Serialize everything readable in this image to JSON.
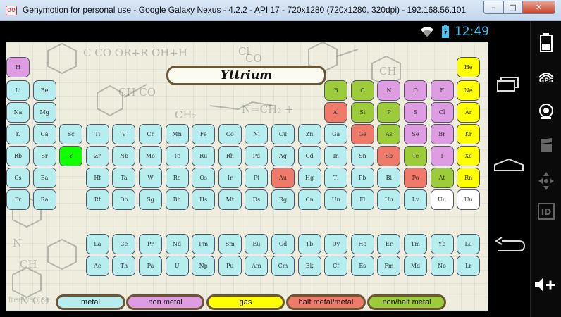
{
  "window": {
    "title": "Genymotion for personal use - Google Galaxy Nexus - 4.2.2 - API 17 - 720x1280 (720x1280, 320dpi) - 192.168.56.101",
    "app_icon": "oo",
    "min_glyph": "–",
    "max_glyph": "□",
    "close_glyph": "✕"
  },
  "status_bar": {
    "time": "12:49",
    "icons": [
      "wifi-icon",
      "battery-icon"
    ]
  },
  "app": {
    "selected_element": "Yttrium",
    "elements": [
      {
        "s": "H",
        "c": "nonmetal",
        "col": 0,
        "row": 0
      },
      {
        "s": "He",
        "c": "gas",
        "col": 17,
        "row": 0
      },
      {
        "s": "Li",
        "c": "metal",
        "col": 0,
        "row": 1
      },
      {
        "s": "Be",
        "c": "metal",
        "col": 1,
        "row": 1
      },
      {
        "s": "B",
        "c": "nonhalf",
        "col": 12,
        "row": 1
      },
      {
        "s": "C",
        "c": "nonhalf",
        "col": 13,
        "row": 1
      },
      {
        "s": "N",
        "c": "nonmetal",
        "col": 14,
        "row": 1
      },
      {
        "s": "O",
        "c": "nonmetal",
        "col": 15,
        "row": 1
      },
      {
        "s": "F",
        "c": "nonmetal",
        "col": 16,
        "row": 1
      },
      {
        "s": "Ne",
        "c": "gas",
        "col": 17,
        "row": 1
      },
      {
        "s": "Na",
        "c": "metal",
        "col": 0,
        "row": 2
      },
      {
        "s": "Mg",
        "c": "metal",
        "col": 1,
        "row": 2
      },
      {
        "s": "Al",
        "c": "halfmetal",
        "col": 12,
        "row": 2
      },
      {
        "s": "Si",
        "c": "nonhalf",
        "col": 13,
        "row": 2
      },
      {
        "s": "P",
        "c": "nonhalf",
        "col": 14,
        "row": 2
      },
      {
        "s": "S",
        "c": "nonmetal",
        "col": 15,
        "row": 2
      },
      {
        "s": "Cl",
        "c": "nonmetal",
        "col": 16,
        "row": 2
      },
      {
        "s": "Ar",
        "c": "gas",
        "col": 17,
        "row": 2
      },
      {
        "s": "K",
        "c": "metal",
        "col": 0,
        "row": 3
      },
      {
        "s": "Ca",
        "c": "metal",
        "col": 1,
        "row": 3
      },
      {
        "s": "Sc",
        "c": "metal",
        "col": 2,
        "row": 3
      },
      {
        "s": "Ti",
        "c": "metal",
        "col": 3,
        "row": 3
      },
      {
        "s": "V",
        "c": "metal",
        "col": 4,
        "row": 3
      },
      {
        "s": "Cr",
        "c": "metal",
        "col": 5,
        "row": 3
      },
      {
        "s": "Mn",
        "c": "metal",
        "col": 6,
        "row": 3
      },
      {
        "s": "Fe",
        "c": "metal",
        "col": 7,
        "row": 3
      },
      {
        "s": "Co",
        "c": "metal",
        "col": 8,
        "row": 3
      },
      {
        "s": "Ni",
        "c": "metal",
        "col": 9,
        "row": 3
      },
      {
        "s": "Cu",
        "c": "metal",
        "col": 10,
        "row": 3
      },
      {
        "s": "Zn",
        "c": "metal",
        "col": 11,
        "row": 3
      },
      {
        "s": "Ga",
        "c": "metal",
        "col": 12,
        "row": 3
      },
      {
        "s": "Ge",
        "c": "halfmetal",
        "col": 13,
        "row": 3
      },
      {
        "s": "As",
        "c": "nonhalf",
        "col": 14,
        "row": 3
      },
      {
        "s": "Se",
        "c": "nonmetal",
        "col": 15,
        "row": 3
      },
      {
        "s": "Br",
        "c": "nonmetal",
        "col": 16,
        "row": 3
      },
      {
        "s": "Kr",
        "c": "gas",
        "col": 17,
        "row": 3
      },
      {
        "s": "Rb",
        "c": "metal",
        "col": 0,
        "row": 4
      },
      {
        "s": "Sr",
        "c": "metal",
        "col": 1,
        "row": 4
      },
      {
        "s": "Y",
        "c": "selected",
        "col": 2,
        "row": 4
      },
      {
        "s": "Zr",
        "c": "metal",
        "col": 3,
        "row": 4
      },
      {
        "s": "Nb",
        "c": "metal",
        "col": 4,
        "row": 4
      },
      {
        "s": "Mo",
        "c": "metal",
        "col": 5,
        "row": 4
      },
      {
        "s": "Tc",
        "c": "metal",
        "col": 6,
        "row": 4
      },
      {
        "s": "Ru",
        "c": "metal",
        "col": 7,
        "row": 4
      },
      {
        "s": "Rh",
        "c": "metal",
        "col": 8,
        "row": 4
      },
      {
        "s": "Pd",
        "c": "metal",
        "col": 9,
        "row": 4
      },
      {
        "s": "Ag",
        "c": "metal",
        "col": 10,
        "row": 4
      },
      {
        "s": "Cd",
        "c": "metal",
        "col": 11,
        "row": 4
      },
      {
        "s": "In",
        "c": "metal",
        "col": 12,
        "row": 4
      },
      {
        "s": "Sn",
        "c": "metal",
        "col": 13,
        "row": 4
      },
      {
        "s": "Sb",
        "c": "halfmetal",
        "col": 14,
        "row": 4
      },
      {
        "s": "Te",
        "c": "nonhalf",
        "col": 15,
        "row": 4
      },
      {
        "s": "I",
        "c": "nonmetal",
        "col": 16,
        "row": 4
      },
      {
        "s": "Xe",
        "c": "gas",
        "col": 17,
        "row": 4
      },
      {
        "s": "Cs",
        "c": "metal",
        "col": 0,
        "row": 5
      },
      {
        "s": "Ba",
        "c": "metal",
        "col": 1,
        "row": 5
      },
      {
        "s": "Hf",
        "c": "metal",
        "col": 3,
        "row": 5
      },
      {
        "s": "Ta",
        "c": "metal",
        "col": 4,
        "row": 5
      },
      {
        "s": "W",
        "c": "metal",
        "col": 5,
        "row": 5
      },
      {
        "s": "Re",
        "c": "metal",
        "col": 6,
        "row": 5
      },
      {
        "s": "Os",
        "c": "metal",
        "col": 7,
        "row": 5
      },
      {
        "s": "Ir",
        "c": "metal",
        "col": 8,
        "row": 5
      },
      {
        "s": "Pt",
        "c": "metal",
        "col": 9,
        "row": 5
      },
      {
        "s": "Au",
        "c": "halfmetal",
        "col": 10,
        "row": 5
      },
      {
        "s": "Hg",
        "c": "metal",
        "col": 11,
        "row": 5
      },
      {
        "s": "Tl",
        "c": "metal",
        "col": 12,
        "row": 5
      },
      {
        "s": "Pb",
        "c": "metal",
        "col": 13,
        "row": 5
      },
      {
        "s": "Bi",
        "c": "metal",
        "col": 14,
        "row": 5
      },
      {
        "s": "Po",
        "c": "halfmetal",
        "col": 15,
        "row": 5
      },
      {
        "s": "At",
        "c": "nonhalf",
        "col": 16,
        "row": 5
      },
      {
        "s": "Rn",
        "c": "gas",
        "col": 17,
        "row": 5
      },
      {
        "s": "Fr",
        "c": "metal",
        "col": 0,
        "row": 6
      },
      {
        "s": "Ra",
        "c": "metal",
        "col": 1,
        "row": 6
      },
      {
        "s": "Rf",
        "c": "metal",
        "col": 3,
        "row": 6
      },
      {
        "s": "Db",
        "c": "metal",
        "col": 4,
        "row": 6
      },
      {
        "s": "Sg",
        "c": "metal",
        "col": 5,
        "row": 6
      },
      {
        "s": "Bh",
        "c": "metal",
        "col": 6,
        "row": 6
      },
      {
        "s": "Hs",
        "c": "metal",
        "col": 7,
        "row": 6
      },
      {
        "s": "Mt",
        "c": "metal",
        "col": 8,
        "row": 6
      },
      {
        "s": "Ds",
        "c": "metal",
        "col": 9,
        "row": 6
      },
      {
        "s": "Rg",
        "c": "metal",
        "col": 10,
        "row": 6
      },
      {
        "s": "Cn",
        "c": "metal",
        "col": 11,
        "row": 6
      },
      {
        "s": "Uu",
        "c": "metal",
        "col": 12,
        "row": 6
      },
      {
        "s": "Fl",
        "c": "metal",
        "col": 13,
        "row": 6
      },
      {
        "s": "Uu",
        "c": "metal",
        "col": 14,
        "row": 6
      },
      {
        "s": "Lv",
        "c": "metal",
        "col": 15,
        "row": 6
      },
      {
        "s": "Uu",
        "c": "unknown",
        "col": 16,
        "row": 6
      },
      {
        "s": "Uu",
        "c": "unknown",
        "col": 17,
        "row": 6
      },
      {
        "s": "La",
        "c": "metal",
        "col": 3,
        "row": 8
      },
      {
        "s": "Ce",
        "c": "metal",
        "col": 4,
        "row": 8
      },
      {
        "s": "Pr",
        "c": "metal",
        "col": 5,
        "row": 8
      },
      {
        "s": "Nd",
        "c": "metal",
        "col": 6,
        "row": 8
      },
      {
        "s": "Pm",
        "c": "metal",
        "col": 7,
        "row": 8
      },
      {
        "s": "Sm",
        "c": "metal",
        "col": 8,
        "row": 8
      },
      {
        "s": "Eu",
        "c": "metal",
        "col": 9,
        "row": 8
      },
      {
        "s": "Gd",
        "c": "metal",
        "col": 10,
        "row": 8
      },
      {
        "s": "Tb",
        "c": "metal",
        "col": 11,
        "row": 8
      },
      {
        "s": "Dy",
        "c": "metal",
        "col": 12,
        "row": 8
      },
      {
        "s": "Ho",
        "c": "metal",
        "col": 13,
        "row": 8
      },
      {
        "s": "Er",
        "c": "metal",
        "col": 14,
        "row": 8
      },
      {
        "s": "Tm",
        "c": "metal",
        "col": 15,
        "row": 8
      },
      {
        "s": "Yb",
        "c": "metal",
        "col": 16,
        "row": 8
      },
      {
        "s": "Lu",
        "c": "metal",
        "col": 17,
        "row": 8
      },
      {
        "s": "Ac",
        "c": "metal",
        "col": 3,
        "row": 9
      },
      {
        "s": "Th",
        "c": "metal",
        "col": 4,
        "row": 9
      },
      {
        "s": "Pa",
        "c": "metal",
        "col": 5,
        "row": 9
      },
      {
        "s": "U",
        "c": "metal",
        "col": 6,
        "row": 9
      },
      {
        "s": "Np",
        "c": "metal",
        "col": 7,
        "row": 9
      },
      {
        "s": "Pu",
        "c": "metal",
        "col": 8,
        "row": 9
      },
      {
        "s": "Am",
        "c": "metal",
        "col": 9,
        "row": 9
      },
      {
        "s": "Cm",
        "c": "metal",
        "col": 10,
        "row": 9
      },
      {
        "s": "Bk",
        "c": "metal",
        "col": 11,
        "row": 9
      },
      {
        "s": "Cf",
        "c": "metal",
        "col": 12,
        "row": 9
      },
      {
        "s": "Es",
        "c": "metal",
        "col": 13,
        "row": 9
      },
      {
        "s": "Fm",
        "c": "metal",
        "col": 14,
        "row": 9
      },
      {
        "s": "Md",
        "c": "metal",
        "col": 15,
        "row": 9
      },
      {
        "s": "No",
        "c": "metal",
        "col": 16,
        "row": 9
      },
      {
        "s": "Lr",
        "c": "metal",
        "col": 17,
        "row": 9
      }
    ],
    "legend": {
      "metal": "metal",
      "non_metal": "non metal",
      "gas": "gas",
      "half_metal": "half metal/metal",
      "non_half_metal": "non/half metal"
    },
    "watermark": "freeweb.se"
  },
  "nav": {
    "back_icon": "back-icon",
    "home_icon": "home-icon",
    "recents_icon": "recent-apps-icon",
    "menu_icon": "menu-icon"
  },
  "sidebar": {
    "gps_label": "GPS",
    "id_label": "ID",
    "icons": [
      "battery-icon",
      "gps-icon",
      "camera-icon",
      "clapper-icon",
      "dpad-icon",
      "id-icon",
      "volume-up-icon"
    ]
  },
  "colors": {
    "metal": "#b6eef0",
    "non_metal": "#de9ce2",
    "gas": "#ffff00",
    "half_metal": "#f07a6a",
    "non_half_metal": "#9ccc3a",
    "selected": "#11ff00",
    "clock": "#44c0f0"
  }
}
